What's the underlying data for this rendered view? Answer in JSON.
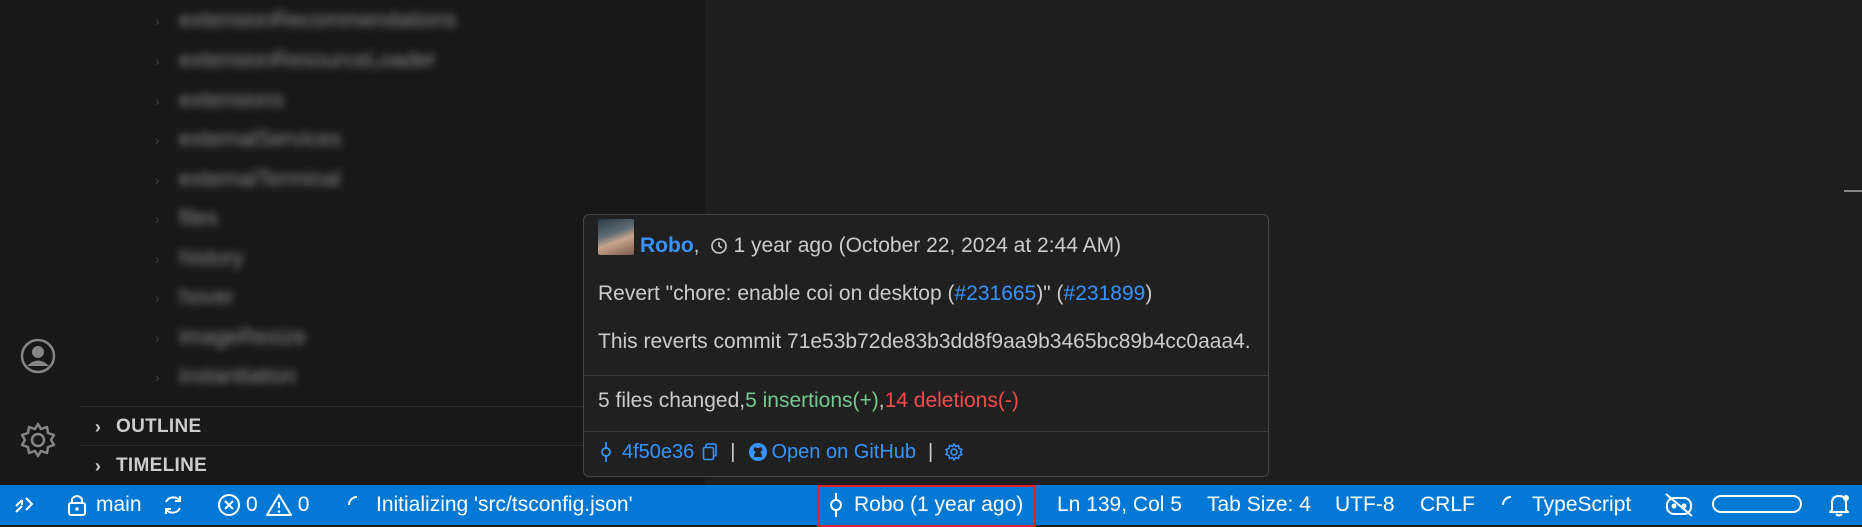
{
  "sidebar": {
    "tree_items": [
      {
        "label": "extensionRecommendations"
      },
      {
        "label": "extensionResourceLoader"
      },
      {
        "label": "extensions"
      },
      {
        "label": "externalServices"
      },
      {
        "label": "externalTerminal"
      },
      {
        "label": "files"
      },
      {
        "label": "history"
      },
      {
        "label": "hover"
      },
      {
        "label": "imageResize"
      },
      {
        "label": "instantiation"
      }
    ],
    "sections": {
      "outline": "OUTLINE",
      "timeline": "TIMELINE"
    }
  },
  "hover": {
    "author": "Robo",
    "author_sep": ",",
    "time": "1 year ago (October 22, 2024 at 2:44 AM)",
    "message_prefix": "Revert \"chore: enable coi on desktop (",
    "message_link1": "#231665",
    "message_mid": ")\" (",
    "message_link2": "#231899",
    "message_suffix": ")",
    "body": "This reverts commit 71e53b72de83b3dd8f9aa9b3465bc89b4cc0aaa4.",
    "stats_files": "5 files changed, ",
    "stats_insertions": "5 insertions(+)",
    "stats_comma": ", ",
    "stats_deletions": "14 deletions(-)",
    "commit_hash": "4f50e36",
    "divider": "|",
    "open_github": "Open on GitHub"
  },
  "statusbar": {
    "branch": "main",
    "errors": "0",
    "warnings": "0",
    "initializing": "Initializing 'src/tsconfig.json'",
    "blame": "Robo (1 year ago)",
    "position": "Ln 139, Col 5",
    "tab_size": "Tab Size: 4",
    "encoding": "UTF-8",
    "eol": "CRLF",
    "language": "TypeScript"
  },
  "colors": {
    "statusbar_bg": "#0078d4",
    "link": "#3794ff",
    "insertions": "#73c991",
    "deletions": "#f14c4c",
    "highlight_border": "#e0202a"
  }
}
